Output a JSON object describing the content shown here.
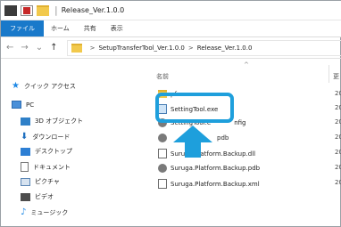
{
  "window": {
    "title": "Release_Ver.1.0.0"
  },
  "ribbon": {
    "tabs": [
      "ファイル",
      "ホーム",
      "共有",
      "表示"
    ]
  },
  "address": {
    "segments": [
      "SetupTransferTool_Ver.1.0.0",
      "Release_Ver.1.0.0"
    ]
  },
  "navpane": {
    "quick_access": "クイック アクセス",
    "pc": "PC",
    "items": [
      "3D オブジェクト",
      "ダウンロード",
      "デスクトップ",
      "ドキュメント",
      "ピクチャ",
      "ビデオ",
      "ミュージック"
    ]
  },
  "filelist": {
    "column_name": "名前",
    "column_right": "更",
    "files": [
      {
        "name": "SettingTool.exe",
        "date": "20"
      },
      {
        "name": "SettingTool.exe.config",
        "date": "20"
      },
      {
        "name": "SettingTool.pdb",
        "date": "20"
      },
      {
        "name": "Suruga.Platform.Backup.dll",
        "date": "20"
      },
      {
        "name": "Suruga.Platform.Backup.pdb",
        "date": "20"
      },
      {
        "name": "Suruga.Platform.Backup.xml",
        "date": "20"
      }
    ],
    "partial_rows": [
      "pf",
      "SettingTool.e",
      "nfig",
      "pdb"
    ],
    "folder_date": "20"
  },
  "colors": {
    "highlight": "#1e9fdc",
    "file_tab": "#1979ca"
  }
}
